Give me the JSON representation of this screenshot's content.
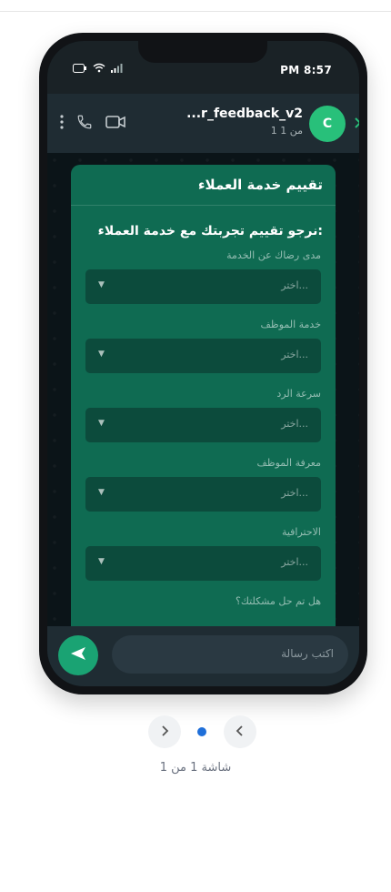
{
  "status": {
    "time": "PM 8:57"
  },
  "chat": {
    "name": "...r_feedback_v2",
    "status": "1 من 1",
    "avatar_letter": "C"
  },
  "form": {
    "title": "تقييم خدمة العملاء",
    "prompt": "نرجو تقييم تجربتك مع خدمة العملاء:",
    "fields": [
      {
        "label": "مدى رضاك عن الخدمة",
        "placeholder": "اختر..."
      },
      {
        "label": "خدمة الموظف",
        "placeholder": "اختر..."
      },
      {
        "label": "سرعة الرد",
        "placeholder": "اختر..."
      },
      {
        "label": "معرفة الموظف",
        "placeholder": "اختر..."
      },
      {
        "label": "الاحترافية",
        "placeholder": "اختر..."
      }
    ],
    "partial_label": "هل تم حل مشكلتك؟"
  },
  "composer": {
    "placeholder": "اكتب رسالة"
  },
  "pager": {
    "caption": "شاشة 1 من 1"
  },
  "colors": {
    "accent": "#1aa373",
    "form_bg": "#0f6b52",
    "avatar": "#28c07a",
    "pager_dot": "#1f6fd9"
  },
  "icons": [
    "more-vertical-icon",
    "phone-icon",
    "video-icon",
    "chevron-right-icon",
    "send-icon",
    "battery-icon",
    "wifi-icon",
    "signal-icon"
  ]
}
